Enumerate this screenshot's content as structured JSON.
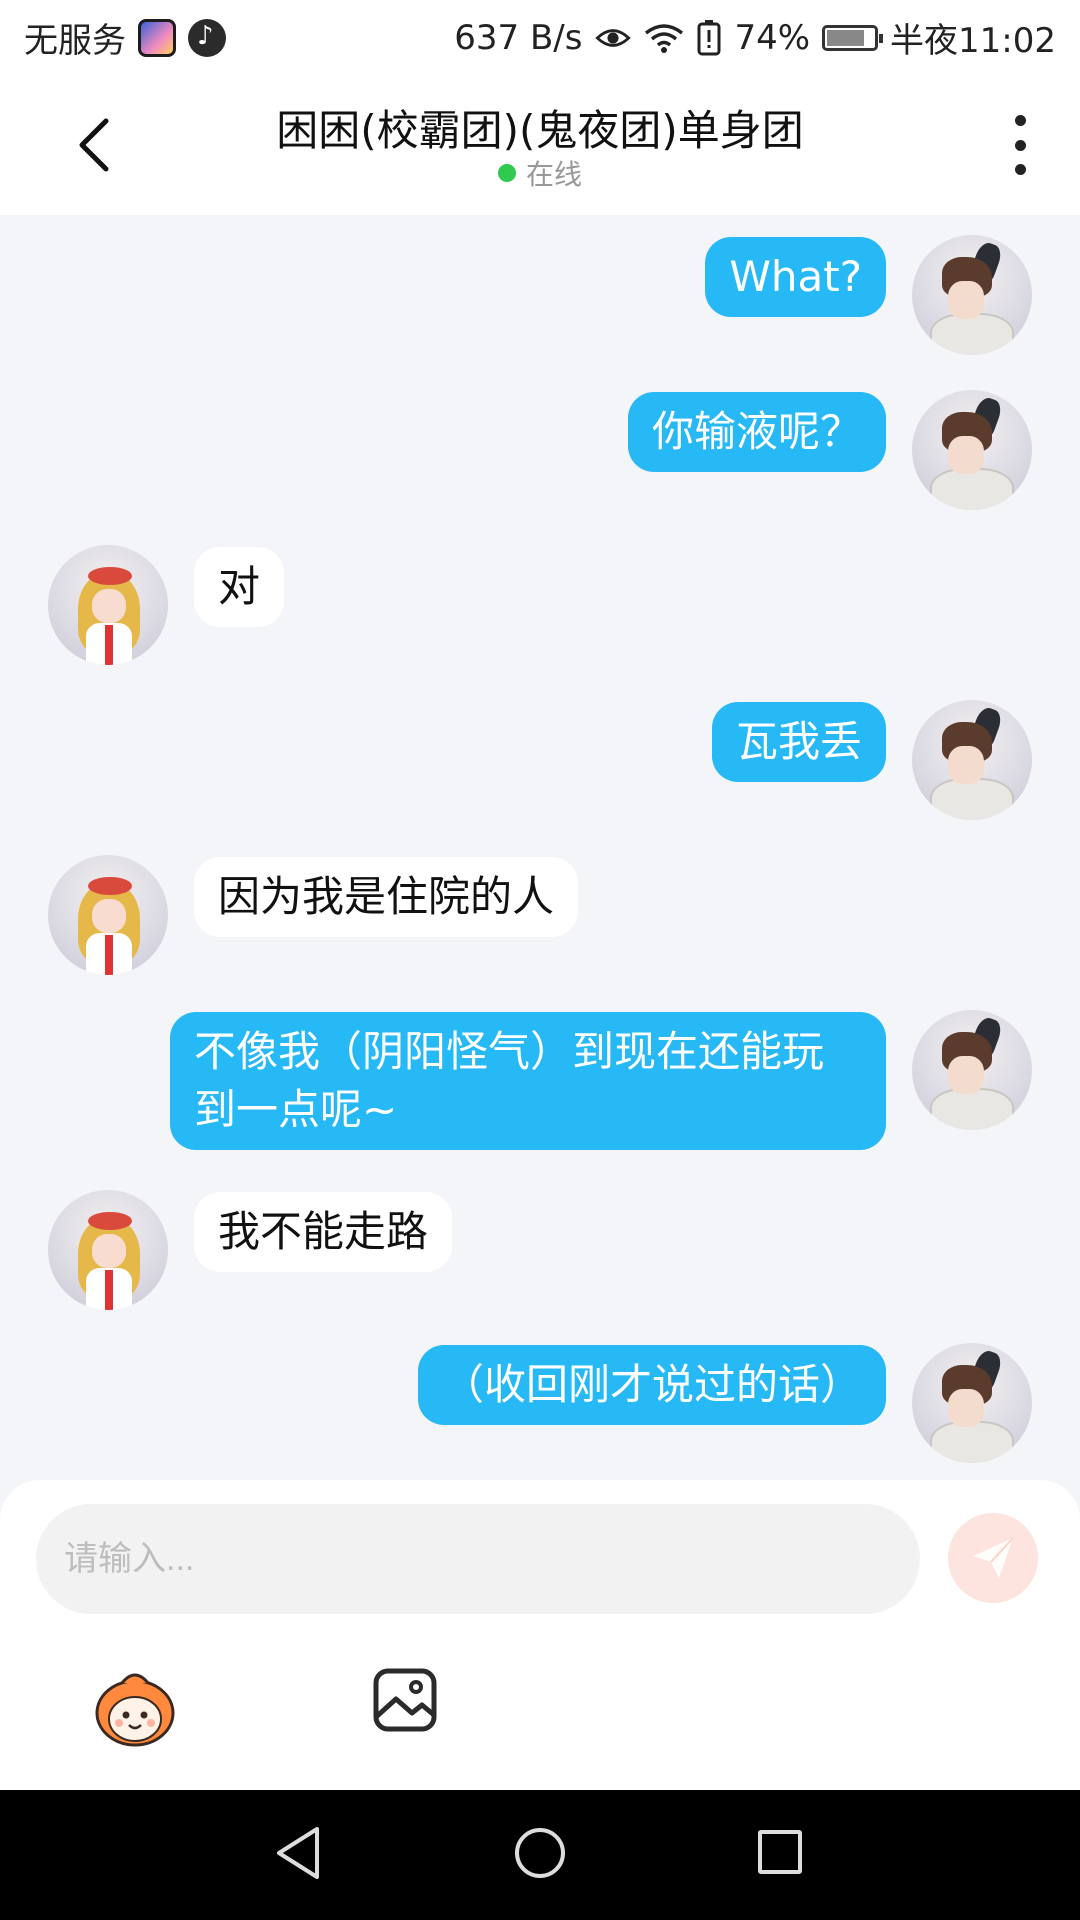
{
  "status_bar": {
    "carrier": "无服务",
    "network_speed": "637 B/s",
    "battery_percent": "74%",
    "time": "半夜11:02"
  },
  "header": {
    "title": "困困(校霸团)(鬼夜团)单身团",
    "online_status": "在线"
  },
  "messages": [
    {
      "side": "right",
      "text": "What?"
    },
    {
      "side": "right",
      "text": "你输液呢？"
    },
    {
      "side": "left",
      "text": "对"
    },
    {
      "side": "right",
      "text": "瓦我丢"
    },
    {
      "side": "left",
      "text": "因为我是住院的人"
    },
    {
      "side": "right",
      "text": "不像我（阴阳怪气）到现在还能玩到一点呢~"
    },
    {
      "side": "left",
      "text": "我不能走路"
    },
    {
      "side": "right",
      "text": "（收回刚才说过的话）"
    }
  ],
  "input": {
    "placeholder": "请输入..."
  },
  "colors": {
    "outgoing_bubble": "#27b8f6",
    "incoming_bubble": "#ffffff",
    "background": "#f3f5f8",
    "online_dot": "#2fca50",
    "send_button": "#fde4df"
  },
  "icons": [
    "back-arrow-icon",
    "more-vert-icon",
    "send-icon",
    "emoji-icon",
    "image-icon",
    "nav-back-icon",
    "nav-home-icon",
    "nav-recent-icon"
  ]
}
